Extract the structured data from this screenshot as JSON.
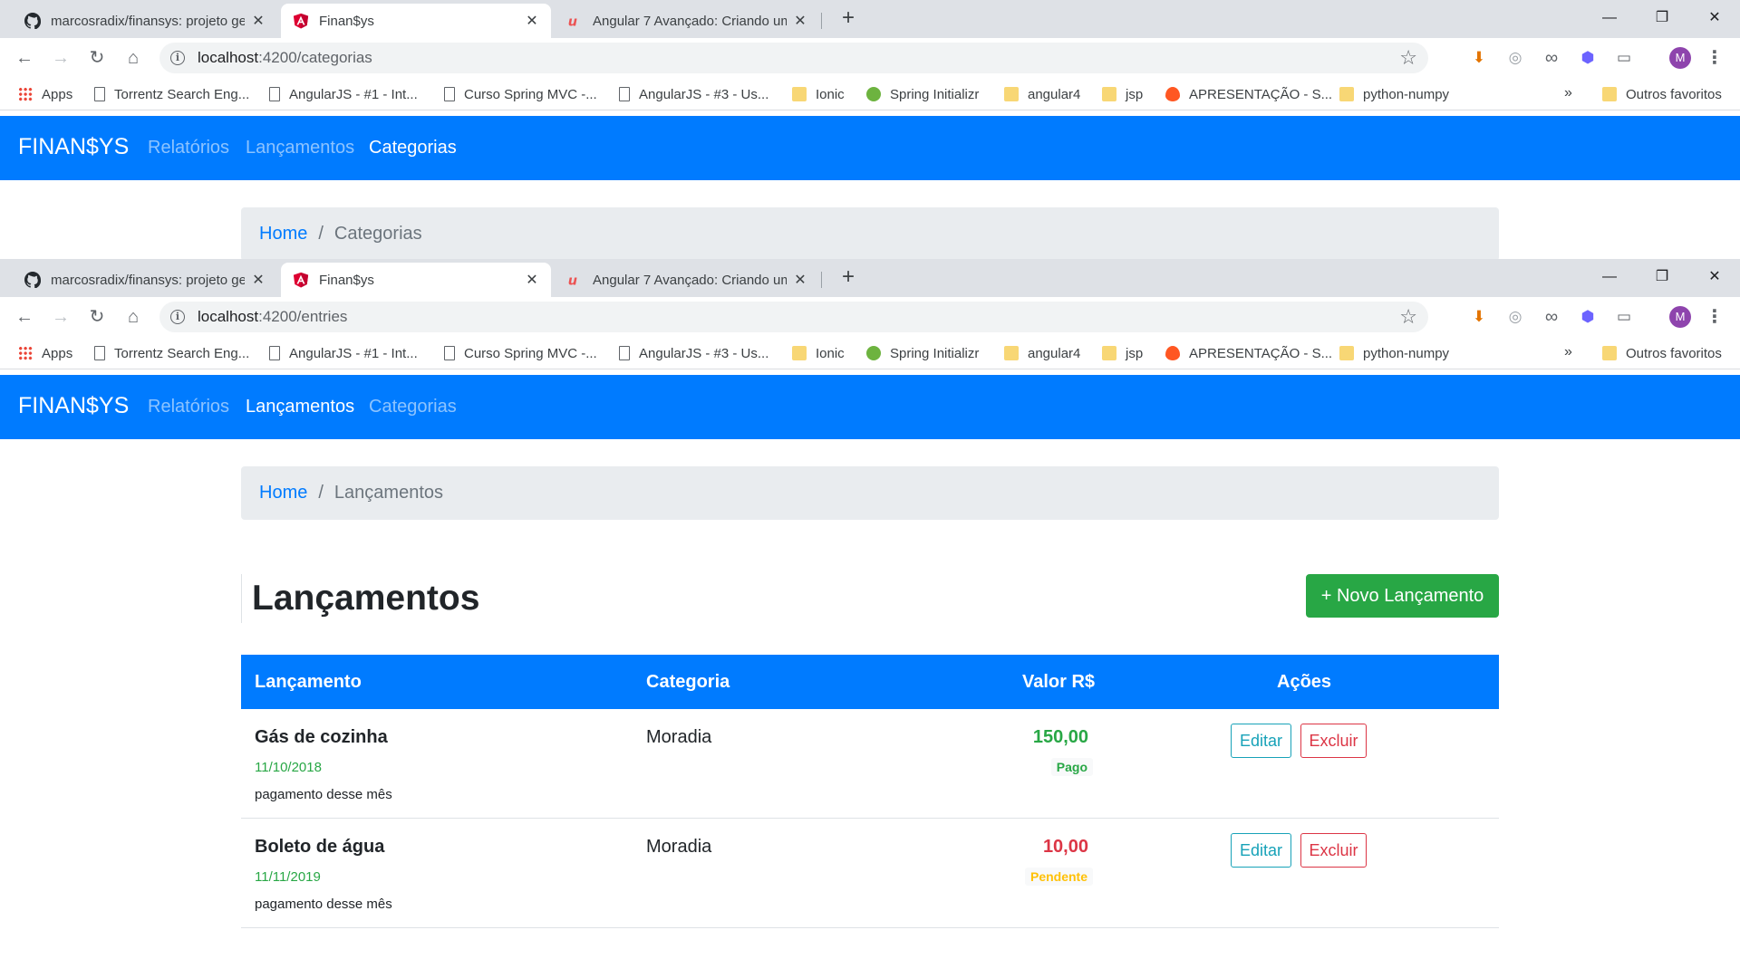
{
  "browser_tabs": [
    {
      "title": "marcosradix/finansys: projeto ge",
      "close": "✕"
    },
    {
      "title": "Finan$ys",
      "close": "✕"
    },
    {
      "title": "Angular 7 Avançado: Criando um",
      "close": "✕"
    }
  ],
  "window_controls": {
    "minimize": "—",
    "restore": "❐",
    "close": "✕",
    "new_tab": "+"
  },
  "bookmarks": [
    {
      "label": "Apps",
      "icon": "apps-grid-icon"
    },
    {
      "label": "Torrentz Search Eng...",
      "icon": "page-icon"
    },
    {
      "label": "AngularJS - #1 - Int...",
      "icon": "page-icon"
    },
    {
      "label": "Curso Spring MVC -...",
      "icon": "page-icon"
    },
    {
      "label": "AngularJS - #3 - Us...",
      "icon": "page-icon"
    },
    {
      "label": "Ionic",
      "icon": "folder-icon"
    },
    {
      "label": "Spring Initializr",
      "icon": "spring-icon"
    },
    {
      "label": "angular4",
      "icon": "folder-icon"
    },
    {
      "label": "jsp",
      "icon": "folder-icon"
    },
    {
      "label": "APRESENTAÇÃO - S...",
      "icon": "fire-icon"
    },
    {
      "label": "python-numpy",
      "icon": "folder-icon"
    }
  ],
  "bookmarks_more": "»",
  "other_bookmarks": "Outros favoritos",
  "profile_initial": "M",
  "shot1": {
    "url_host": "localhost",
    "url_path": ":4200/categorias",
    "nav": {
      "brand": "FINAN$YS",
      "links": [
        "Relatórios",
        "Lançamentos",
        "Categorias"
      ],
      "active": "Categorias"
    },
    "breadcrumb": {
      "home": "Home",
      "sep": "/",
      "current": "Categorias"
    }
  },
  "shot2": {
    "url_host": "localhost",
    "url_path": ":4200/entries",
    "nav": {
      "brand": "FINAN$YS",
      "links": [
        "Relatórios",
        "Lançamentos",
        "Categorias"
      ],
      "active": "Lançamentos"
    },
    "breadcrumb": {
      "home": "Home",
      "sep": "/",
      "current": "Lançamentos"
    },
    "page_title": "Lançamentos",
    "new_button": "+ Novo Lançamento",
    "table": {
      "headers": [
        "Lançamento",
        "Categoria",
        "Valor R$",
        "Ações"
      ],
      "rows": [
        {
          "name": "Gás de cozinha",
          "date": "11/10/2018",
          "description": "pagamento desse mês",
          "category": "Moradia",
          "amount": "150,00",
          "status": "Pago",
          "edit": "Editar",
          "delete": "Excluir"
        },
        {
          "name": "Boleto de água",
          "date": "11/11/2019",
          "description": "pagamento desse mês",
          "category": "Moradia",
          "amount": "10,00",
          "status": "Pendente",
          "edit": "Editar",
          "delete": "Excluir"
        }
      ]
    }
  },
  "colors": {
    "primary": "#007bff",
    "success": "#28a745",
    "danger": "#dc3545",
    "warning": "#ffc107",
    "info": "#17a2b8"
  }
}
